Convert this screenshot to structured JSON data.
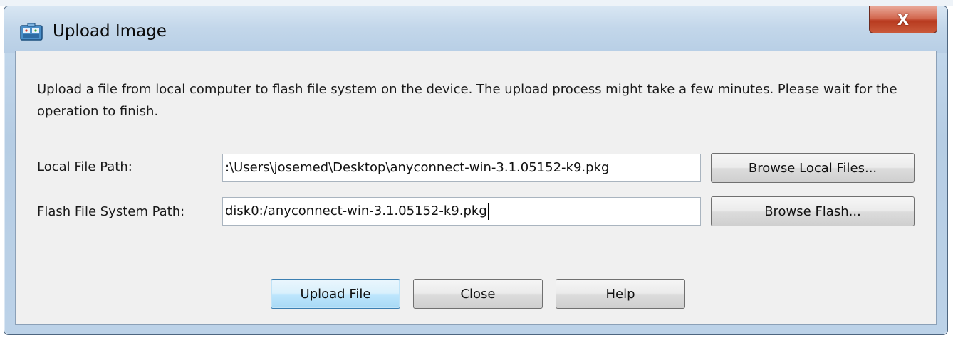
{
  "window": {
    "title": "Upload Image",
    "close_glyph": "X",
    "title_icon": "upload-image-icon"
  },
  "dialog": {
    "description": "Upload a file from local computer to flash file system on the device. The upload process might take a few minutes. Please wait for the operation to finish.",
    "local_file": {
      "label": "Local File Path:",
      "value": ":\\Users\\josemed\\Desktop\\anyconnect-win-3.1.05152-k9.pkg",
      "button": "Browse Local Files..."
    },
    "flash_file": {
      "label": "Flash File System Path:",
      "value": "disk0:/anyconnect-win-3.1.05152-k9.pkg",
      "button": "Browse Flash..."
    },
    "buttons": {
      "upload": "Upload File",
      "close": "Close",
      "help": "Help"
    }
  },
  "colors": {
    "titlebar": "#c3d7ea",
    "close_button": "#c9593a",
    "default_button_border": "#3c7fb1"
  }
}
